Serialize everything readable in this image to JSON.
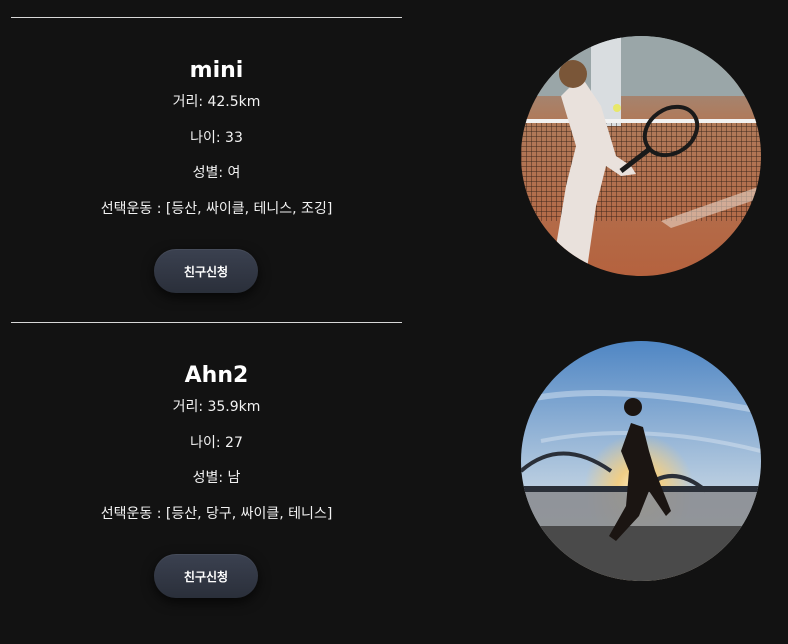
{
  "users": [
    {
      "name": "mini",
      "distance": "거리: 42.5km",
      "age": "나이: 33",
      "gender": "성별: 여",
      "sports": "선택운동 : [등산, 싸이클, 테니스, 조깅]",
      "button_label": "친구신청",
      "photo": "tennis-player-photo"
    },
    {
      "name": "Ahn2",
      "distance": "거리: 35.9km",
      "age": "나이: 27",
      "gender": "성별: 남",
      "sports": "선택운동 : [등산, 당구, 싸이클, 테니스]",
      "button_label": "친구신청",
      "photo": "runner-sunset-photo"
    }
  ]
}
